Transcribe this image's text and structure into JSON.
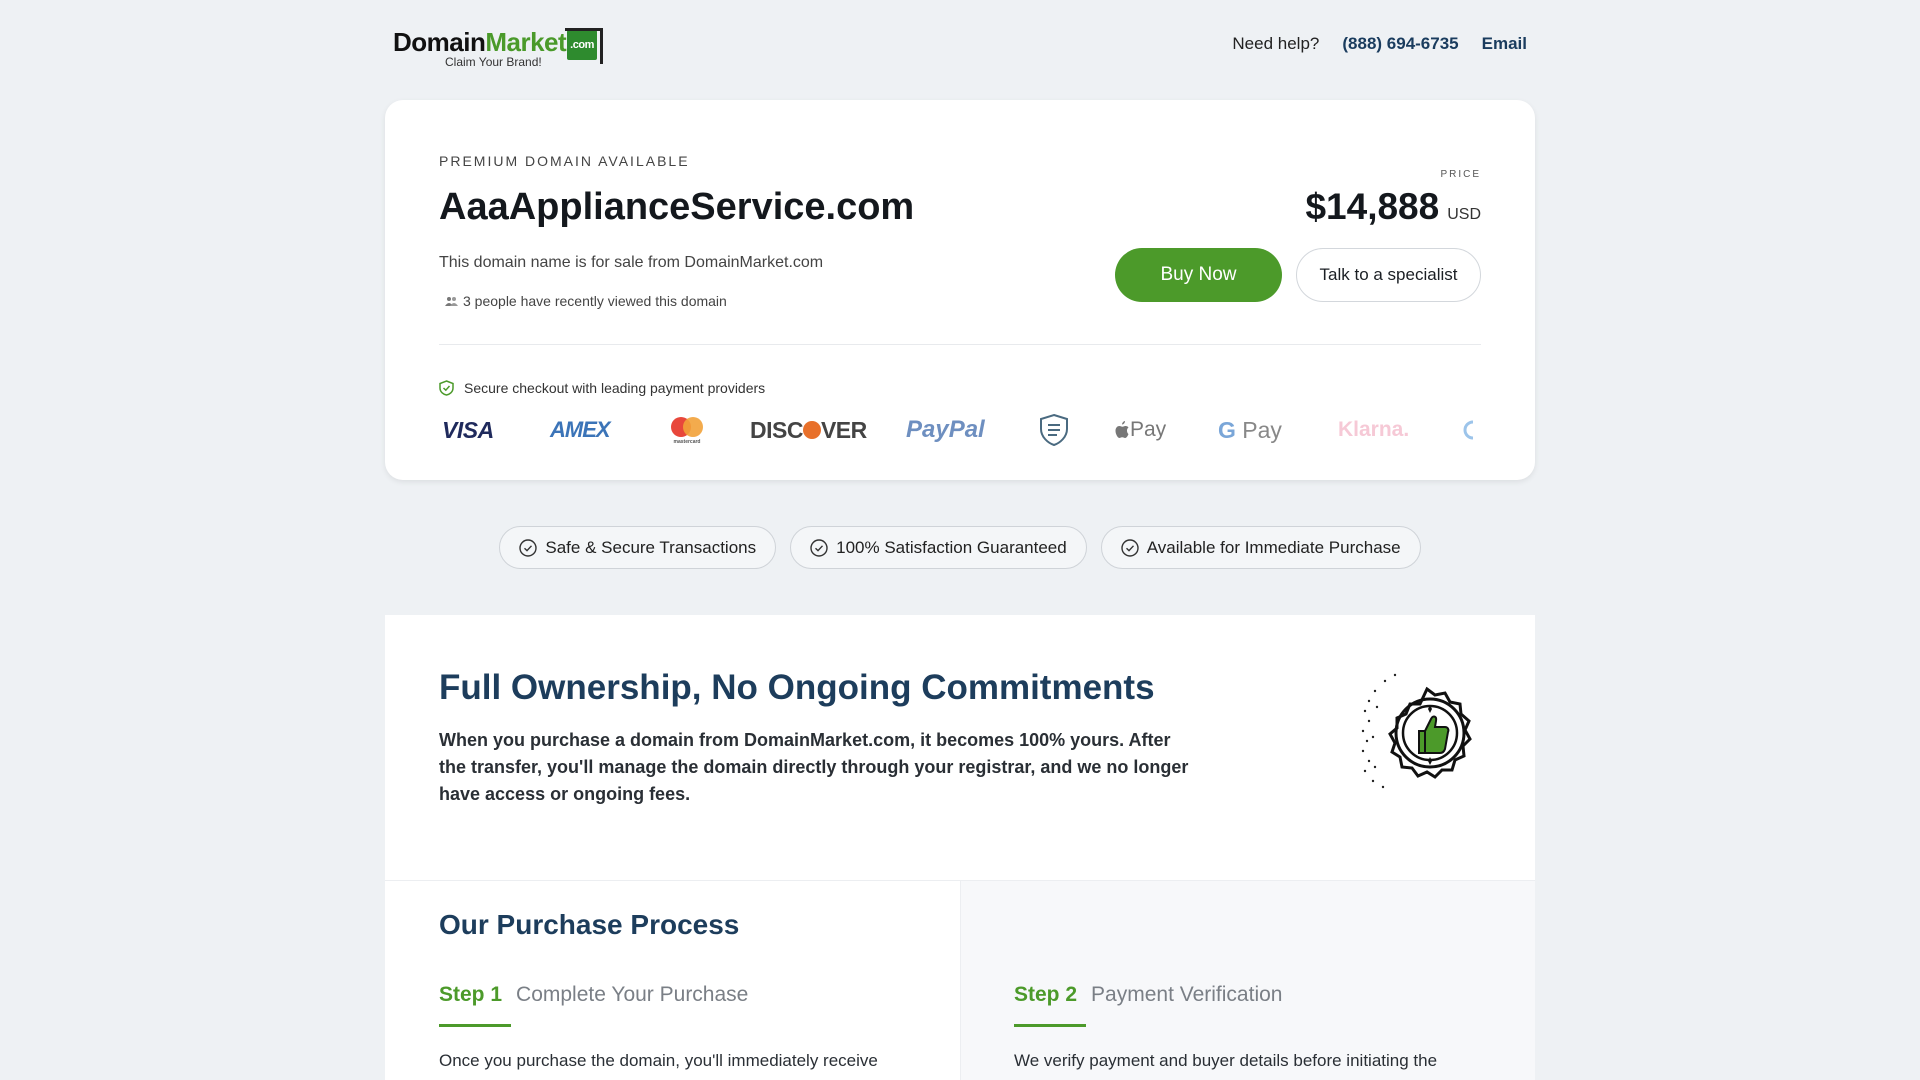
{
  "header": {
    "logo_text_1": "Domain",
    "logo_text_2": "Market",
    "logo_com": ".com",
    "logo_tagline": "Claim Your Brand!",
    "need_help": "Need help?",
    "phone": "(888) 694-6735",
    "email": "Email"
  },
  "listing": {
    "eyebrow": "PREMIUM DOMAIN AVAILABLE",
    "domain": "AaaApplianceService.com",
    "for_sale_text": "This domain name is for sale from DomainMarket.com",
    "viewed_text": "3 people have recently viewed this domain",
    "price_label": "PRICE",
    "price": "$14,888",
    "currency": "USD",
    "buy_label": "Buy Now",
    "talk_label": "Talk to a specialist",
    "secure_text": "Secure checkout with leading payment providers",
    "payment_providers": {
      "visa": "VISA",
      "amex": "AMEX",
      "mastercard": "mastercard",
      "discover_a": "DISC",
      "discover_b": "VER",
      "paypal": "PayPal",
      "apple_pay": "Pay",
      "google_pay": "Pay",
      "google_g": "G",
      "klarna": "Klarna."
    }
  },
  "badges": [
    "Safe & Secure Transactions",
    "100% Satisfaction Guaranteed",
    "Available for Immediate Purchase"
  ],
  "ownership": {
    "title": "Full Ownership, No Ongoing Commitments",
    "body": "When you purchase a domain from DomainMarket.com, it becomes 100% yours. After the transfer, you'll manage the domain directly through your registrar, and we no longer have access or ongoing fees."
  },
  "process": {
    "title": "Our Purchase Process",
    "steps": [
      {
        "num": "Step 1",
        "name": "Complete Your Purchase",
        "text": "Once you purchase the domain, you'll immediately receive an email confirmation from us."
      },
      {
        "num": "Step 2",
        "name": "Payment Verification",
        "text": "We verify payment and buyer details before initiating the transfer."
      }
    ]
  },
  "colors": {
    "brand_green": "#4c9a2a",
    "heading_blue": "#1d3d5c",
    "page_bg": "#eef1f4"
  }
}
